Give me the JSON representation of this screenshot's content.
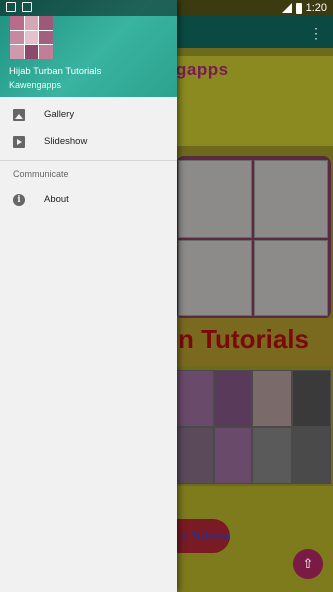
{
  "drawer": {
    "header": {
      "title": "Hijab Turban Tutorials",
      "subtitle": "Kawengapps"
    },
    "items": [
      {
        "label": "Gallery",
        "icon": "gallery-icon"
      },
      {
        "label": "Slideshow",
        "icon": "slideshow-icon"
      }
    ],
    "section": {
      "title": "Communicate",
      "items": [
        {
          "label": "About",
          "icon": "info-icon"
        }
      ]
    }
  },
  "status_bar": {
    "time": "1:20"
  },
  "background": {
    "logo_text": "gapps",
    "banner_title": "n Tutorials",
    "button_text": "n Tutorials"
  },
  "colors": {
    "header_teal": "#2ba28e",
    "toolbar": "#0b4a43",
    "drawer_bg": "#f1f1f1"
  }
}
